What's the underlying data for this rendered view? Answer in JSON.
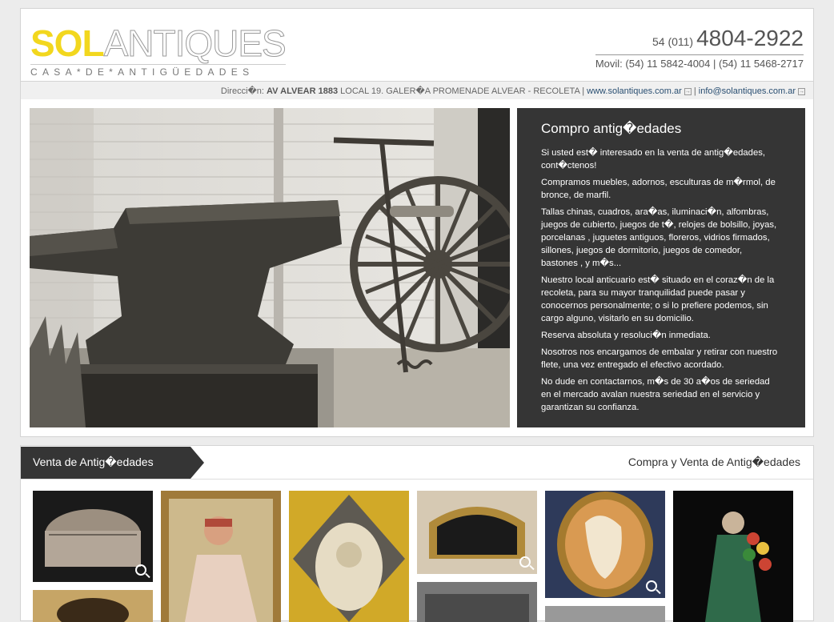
{
  "header": {
    "logo_sol": "SOL",
    "logo_antiques": "ANTIQUES",
    "logo_sub": "CASA*DE*ANTIGÜEDADES",
    "phone_prefix": "54 (011)",
    "phone_main": "4804-2922",
    "phone_mobile": "Movil: (54) 11 5842-4004 | (54) 11 5468-2717"
  },
  "address": {
    "label": "Direcci�n:",
    "street": "AV ALVEAR 1883",
    "rest": "LOCAL 19. GALER�A PROMENADE ALVEAR - RECOLETA |",
    "website": "www.solantiques.com.ar",
    "separator": "|",
    "email": "info@solantiques.com.ar"
  },
  "info": {
    "title": "Compro antig�edades",
    "paragraphs": [
      "Si usted est� interesado en la venta de antig�edades, cont�ctenos!",
      "Compramos muebles, adornos, esculturas de m�rmol, de bronce, de marfil.",
      "Tallas chinas, cuadros, ara�as, iluminaci�n, alfombras, juegos de cubierto, juegos de t�, relojes de bolsillo, joyas, porcelanas , juguetes antiguos, floreros, vidrios firmados, sillones, juegos de dormitorio, juegos de comedor, bastones , y m�s...",
      "Nuestro local anticuario est� situado en el coraz�n de la recoleta, para su mayor tranquilidad puede pasar y conocernos personalmente; o si lo prefiere podemos, sin cargo alguno, visitarlo en su domicilio.",
      "Reserva absoluta y resoluci�n inmediata.",
      "Nosotros nos encargamos de embalar y retirar con nuestro flete, una vez entregado el efectivo acordado.",
      "No dude en contactarnos, m�s de 30 a�os de seriedad en el mercado avalan nuestra seriedad en el servicio y garantizan su confianza."
    ]
  },
  "gallery": {
    "tab_label": "Venta de Antig�edades",
    "right_label": "Compra y Venta de Antig�edades"
  },
  "colors": {
    "logo_yellow": "#f2d71e",
    "dark_panel": "#353535",
    "link": "#2a4f72"
  },
  "icons": [
    "external-link-icon",
    "zoom-icon"
  ]
}
